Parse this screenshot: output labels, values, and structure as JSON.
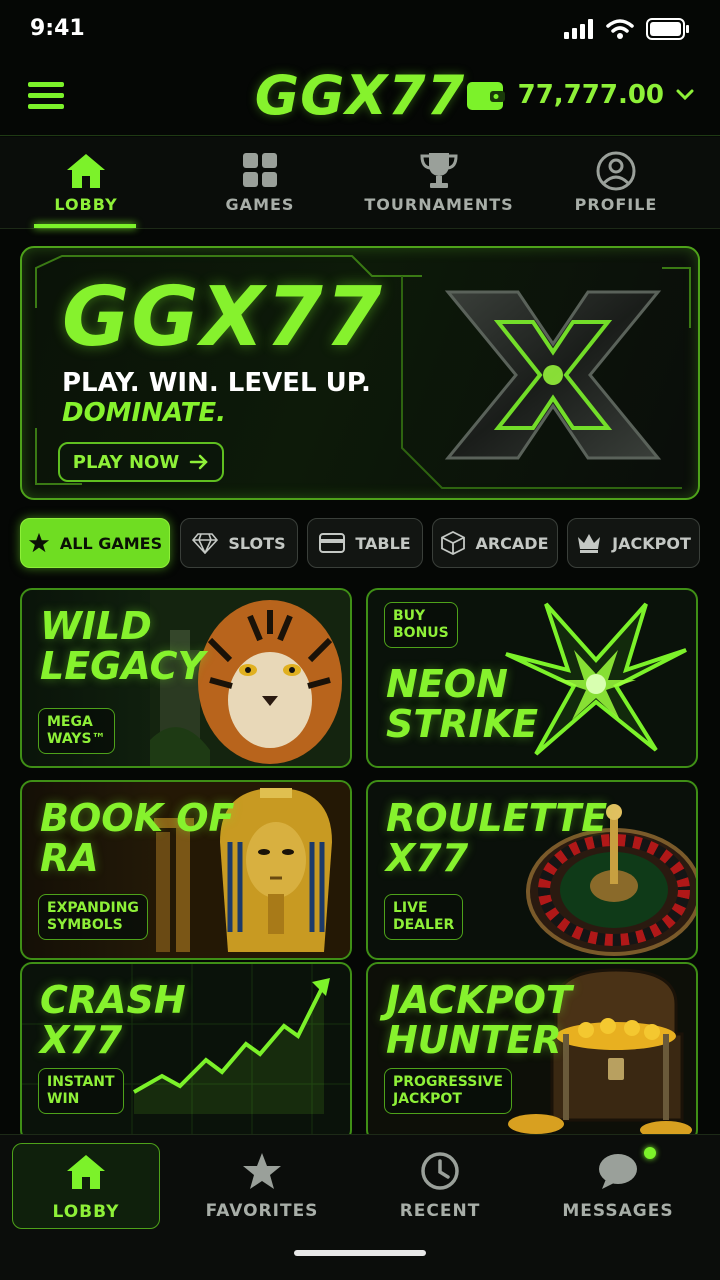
{
  "status_bar": {
    "time": "9:41"
  },
  "header": {
    "logo": "GGX77",
    "balance": "77,777.00"
  },
  "top_nav": [
    {
      "label": "LOBBY",
      "icon": "home-icon",
      "active": true
    },
    {
      "label": "GAMES",
      "icon": "grid-icon",
      "active": false
    },
    {
      "label": "TOURNAMENTS",
      "icon": "trophy-icon",
      "active": false
    },
    {
      "label": "PROFILE",
      "icon": "user-icon",
      "active": false
    }
  ],
  "hero": {
    "title": "GGX77",
    "line1": "PLAY. WIN. LEVEL UP.",
    "line2": "DOMINATE.",
    "cta": "PLAY NOW"
  },
  "filters": [
    {
      "label": "ALL GAMES",
      "icon": "star-icon",
      "active": true
    },
    {
      "label": "SLOTS",
      "icon": "diamond-icon",
      "active": false
    },
    {
      "label": "TABLE",
      "icon": "card-icon",
      "active": false
    },
    {
      "label": "ARCADE",
      "icon": "cube-icon",
      "active": false
    },
    {
      "label": "JACKPOT",
      "icon": "crown-icon",
      "active": false
    }
  ],
  "games": [
    {
      "title": "WILD\nLEGACY",
      "badge": "MEGA\nWAYS™",
      "art": "tiger"
    },
    {
      "title": "NEON\nSTRIKE",
      "badge": "BUY\nBONUS",
      "art": "neon-x"
    },
    {
      "title": "BOOK OF\nRA",
      "badge": "EXPANDING\nSYMBOLS",
      "art": "pharaoh"
    },
    {
      "title": "ROULETTE\nX77",
      "badge": "LIVE\nDEALER",
      "art": "roulette"
    },
    {
      "title": "CRASH\nX77",
      "badge": "INSTANT\nWIN",
      "art": "chart"
    },
    {
      "title": "JACKPOT\nHUNTER",
      "badge": "PROGRESSIVE\nJACKPOT",
      "art": "chest"
    }
  ],
  "bottom_nav": [
    {
      "label": "LOBBY",
      "icon": "home-icon",
      "active": true
    },
    {
      "label": "FAVORITES",
      "icon": "star-icon",
      "active": false
    },
    {
      "label": "RECENT",
      "icon": "clock-icon",
      "active": false
    },
    {
      "label": "MESSAGES",
      "icon": "chat-icon",
      "active": false
    }
  ],
  "colors": {
    "accent": "#86f22d",
    "background": "#050705",
    "border": "#3f8f16"
  }
}
